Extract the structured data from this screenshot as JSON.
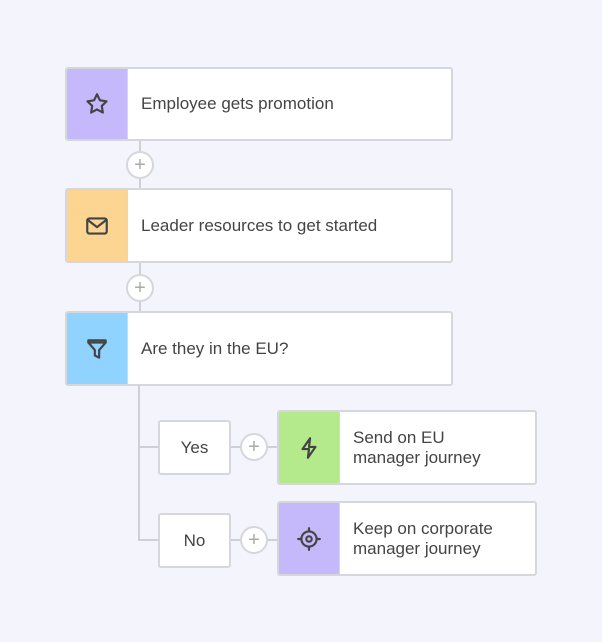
{
  "steps": [
    {
      "label": "Employee gets promotion",
      "icon": "star-icon",
      "color": "#c5b9fc"
    },
    {
      "label": "Leader resources to get started",
      "icon": "mail-icon",
      "color": "#fdd593"
    },
    {
      "label": "Are they in the EU?",
      "icon": "filter-icon",
      "color": "#8fd3fe"
    }
  ],
  "branches": [
    {
      "condition": "Yes",
      "label": "Send on EU manager journey",
      "icon": "lightning-icon",
      "color": "#b5ea8c"
    },
    {
      "condition": "No",
      "label": "Keep on corporate manager journey",
      "icon": "target-icon",
      "color": "#c5b9fc"
    }
  ],
  "add_symbol": "+"
}
